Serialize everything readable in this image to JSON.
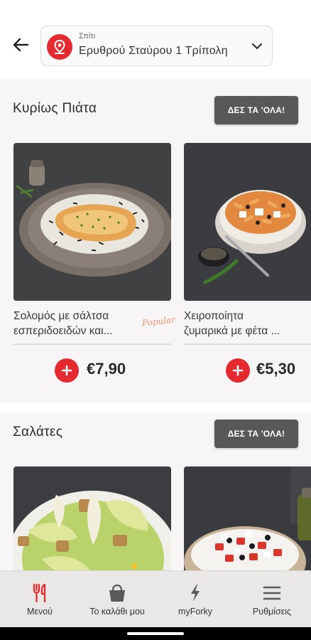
{
  "header": {
    "address_label": "Σπίτι",
    "address_value": "Ερυθρού Σταύρου 1 Τρίπολη"
  },
  "sections": [
    {
      "title": "Κυρίως Πιάτα",
      "see_all_label": "ΔΕΣ ΤΑ 'ΟΛΑ!",
      "products": [
        {
          "name_line1": "Σολομός με σάλτσα",
          "name_line2": "εσπεριδοειδών και...",
          "badge": "Popular",
          "price": "€7,90"
        },
        {
          "name_line1": "Χειροποίητα",
          "name_line2": "ζυμαρικά με φέτα ...",
          "price": "€5,30"
        }
      ]
    },
    {
      "title": "Σαλάτες",
      "see_all_label": "ΔΕΣ ΤΑ 'ΟΛΑ!"
    }
  ],
  "bottom_nav": [
    {
      "label": "Μενού",
      "icon": "fork-knife-icon"
    },
    {
      "label": "Το καλάθι μου",
      "icon": "basket-icon"
    },
    {
      "label": "myForky",
      "icon": "lightning-icon"
    },
    {
      "label": "Ρυθμίσεις",
      "icon": "menu-icon"
    }
  ],
  "colors": {
    "accent_red": "#e42a2e",
    "button_gray": "#585858",
    "section_bg": "#f7f5f5",
    "nav_bg": "#eae7e7",
    "popular_badge": "#f2906b"
  }
}
